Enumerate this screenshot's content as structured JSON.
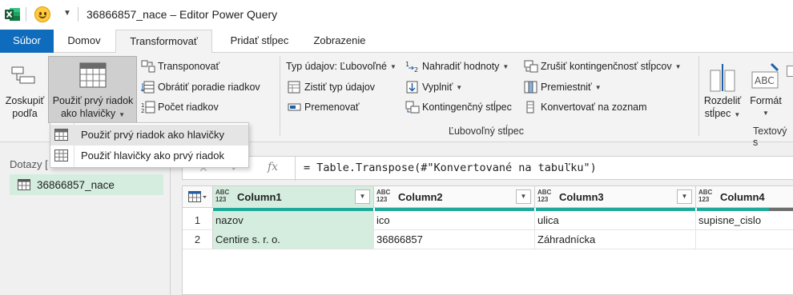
{
  "window": {
    "title": "36866857_nace – Editor Power Query"
  },
  "tabs": {
    "file": "Súbor",
    "home": "Domov",
    "transform": "Transformovať",
    "add_column": "Pridať stĺpec",
    "view": "Zobrazenie"
  },
  "ribbon": {
    "group_by": {
      "line1": "Zoskupiť",
      "line2": "podľa"
    },
    "use_first_row": {
      "line1": "Použiť prvý riadok",
      "line2": "ako hlavičky"
    },
    "transpose": "Transponovať",
    "reverse_rows": "Obrátiť poradie riadkov",
    "count_rows": "Počet riadkov",
    "data_type": "Typ údajov: Ľubovoľné",
    "detect_type": "Zistiť typ údajov",
    "rename": "Premenovať",
    "replace_values": "Nahradiť hodnoty",
    "fill": "Vyplniť",
    "pivot_column": "Kontingenčný stĺpec",
    "unpivot": "Zrušiť kontingenčnosť stĺpcov",
    "move": "Premiestniť",
    "convert_to_list": "Konvertovať na zoznam",
    "any_column_group": "Ľubovoľný stĺpec",
    "split_column": {
      "line1": "Rozdeliť",
      "line2": "stĺpec"
    },
    "format": "Formát",
    "text_column_group": "Textový s"
  },
  "menu": {
    "items": [
      {
        "label": "Použiť prvý riadok ako hlavičky"
      },
      {
        "label": "Použiť hlavičky ako prvý riadok"
      }
    ]
  },
  "queries": {
    "header": "Dotazy [",
    "items": [
      {
        "name": "36866857_nace"
      }
    ]
  },
  "formula_bar": {
    "fx": "fx",
    "formula": "= Table.Transpose(#\"Konvertované na tabuľku\")"
  },
  "grid": {
    "type_badge": {
      "line1": "ABC",
      "line2": "123"
    },
    "columns": [
      "Column1",
      "Column2",
      "Column3",
      "Column4"
    ],
    "rows": [
      {
        "num": "1",
        "cells": [
          "nazov",
          "ico",
          "ulica",
          "supisne_cislo"
        ]
      },
      {
        "num": "2",
        "cells": [
          "Centire s. r. o.",
          "36866857",
          "Záhradnícka",
          ""
        ]
      }
    ]
  },
  "colors": {
    "excel_green": "#1d6f42",
    "file_tab": "#0f6cbd",
    "selection": "#d4edde",
    "quality_bar": "#1ea99b"
  }
}
